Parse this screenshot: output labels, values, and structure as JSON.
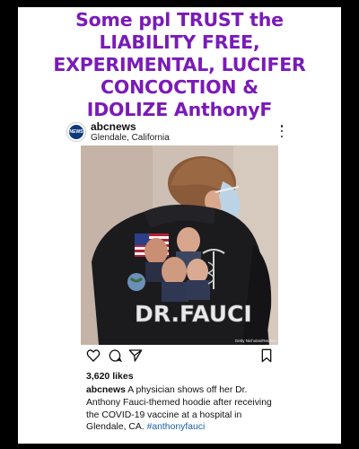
{
  "headline": {
    "lines": [
      "Some ppl TRUST the",
      "LIABILITY FREE,",
      "EXPERIMENTAL, LUCIFER",
      "CONCOCTION &",
      "IDOLIZE AnthonyF"
    ]
  },
  "post": {
    "avatar_text": "NEWS",
    "account": "abcnews",
    "location": "Glendale, California",
    "image": {
      "hoodie_text": "DR.FAUCI",
      "credit": "Getty Nicholas/Reuters"
    },
    "likes": "3,620 likes",
    "caption": {
      "account": "abcnews",
      "text": " A physician shows off her Dr. Anthony Fauci-themed hoodie after receiving the COVID-19 vaccine at a hospital in Glendale, CA. ",
      "hashtag": "#anthonyfauci"
    }
  },
  "colors": {
    "headline": "#7a1bb8",
    "background": "#000000",
    "hashtag": "#1c5fa8"
  },
  "icons": {
    "like": "heart-icon",
    "comment": "comment-icon",
    "share": "send-icon",
    "save": "bookmark-icon",
    "more": "more-options-icon"
  }
}
